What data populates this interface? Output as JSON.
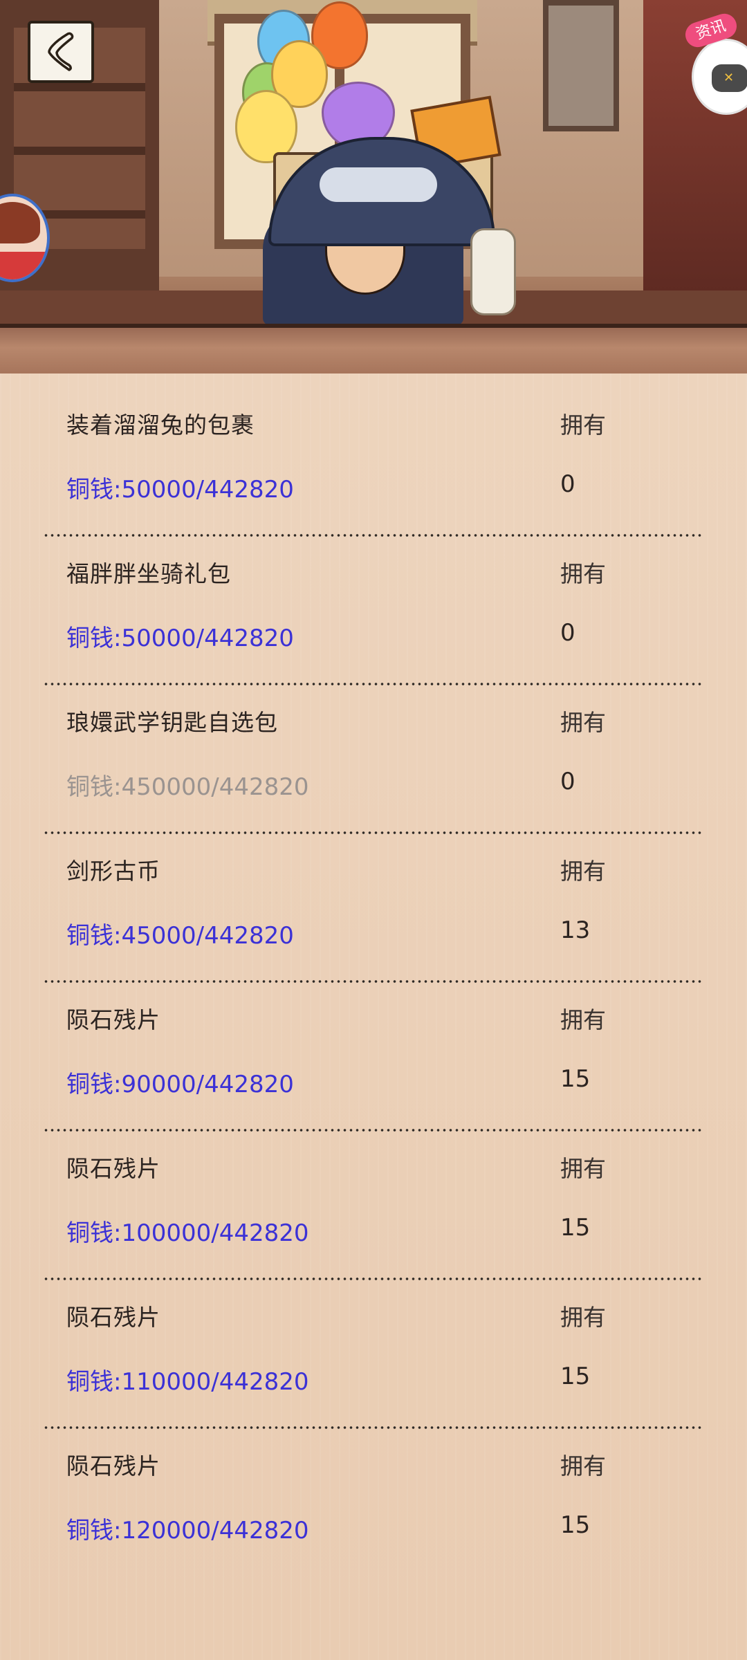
{
  "header": {
    "back_icon": "back-arrow-icon",
    "news_badge": "资讯",
    "news_icon": "gamepad-icon"
  },
  "colors": {
    "price_affordable": "#3b31d6",
    "price_unaffordable": "#9a9390",
    "text_primary": "#2b2320",
    "background": "#ead0b8",
    "news_badge_bg": "#ef4d7e"
  },
  "items": [
    {
      "name": "装着溜溜兔的包裹",
      "price": "铜钱:50000/442820",
      "have_label": "拥有",
      "count": "0",
      "affordable": true
    },
    {
      "name": "福胖胖坐骑礼包",
      "price": "铜钱:50000/442820",
      "have_label": "拥有",
      "count": "0",
      "affordable": true
    },
    {
      "name": "琅嬛武学钥匙自选包",
      "price": "铜钱:450000/442820",
      "have_label": "拥有",
      "count": "0",
      "affordable": false
    },
    {
      "name": "剑形古币",
      "price": "铜钱:45000/442820",
      "have_label": "拥有",
      "count": "13",
      "affordable": true
    },
    {
      "name": "陨石残片",
      "price": "铜钱:90000/442820",
      "have_label": "拥有",
      "count": "15",
      "affordable": true
    },
    {
      "name": "陨石残片",
      "price": "铜钱:100000/442820",
      "have_label": "拥有",
      "count": "15",
      "affordable": true
    },
    {
      "name": "陨石残片",
      "price": "铜钱:110000/442820",
      "have_label": "拥有",
      "count": "15",
      "affordable": true
    },
    {
      "name": "陨石残片",
      "price": "铜钱:120000/442820",
      "have_label": "拥有",
      "count": "15",
      "affordable": true
    }
  ]
}
